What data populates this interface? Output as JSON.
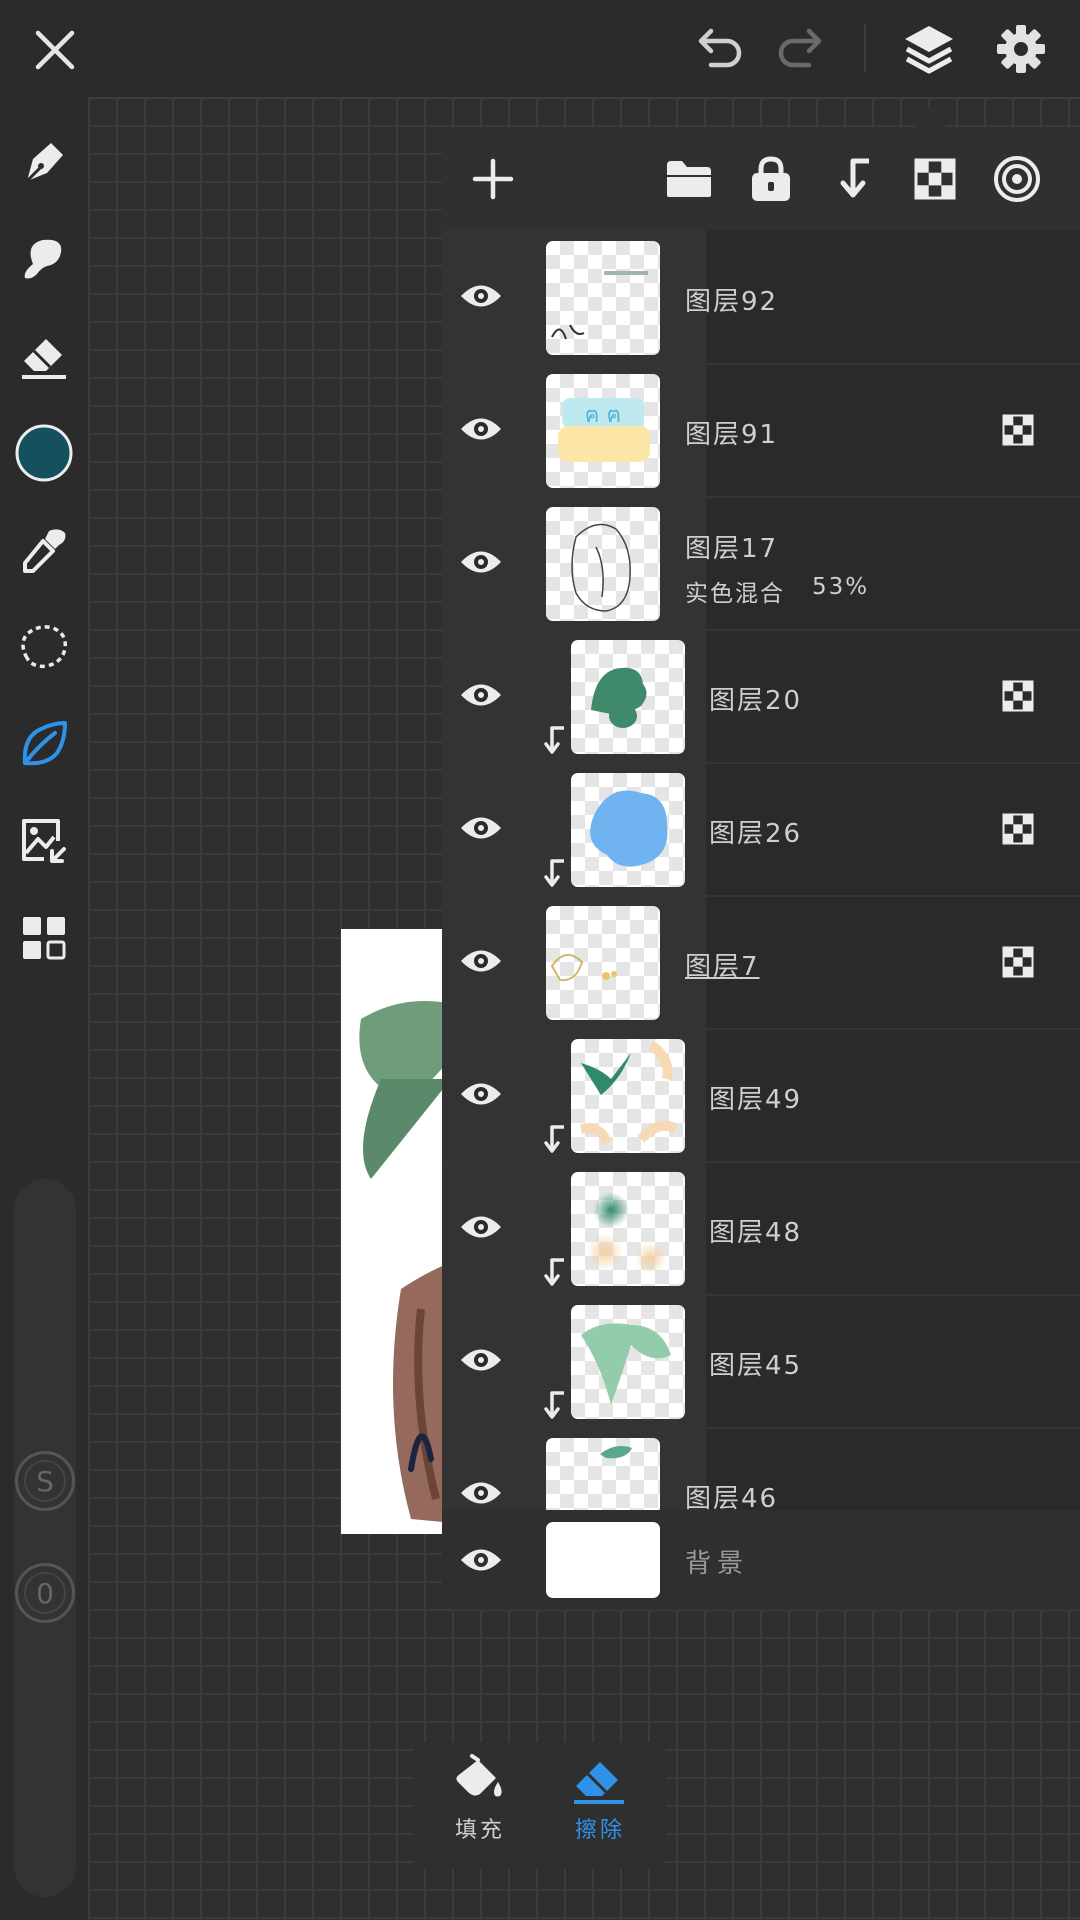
{
  "toolbar": {
    "close": "close-icon",
    "undo": "undo-icon",
    "redo": "redo-icon",
    "layers": "layers-icon",
    "settings": "gear-icon"
  },
  "left_tools": {
    "items": [
      "pen-icon",
      "smudge-icon",
      "eraser-icon",
      "color-swatch",
      "eyedropper-icon",
      "lasso-icon",
      "leaf-icon",
      "import-image-icon",
      "grid-icon"
    ],
    "current_color": "#15505e",
    "active_color": "#2e93e8",
    "size_label": "S",
    "opacity_label": "0"
  },
  "panel_header": {
    "icons": [
      "add-layer-icon",
      "folder-icon",
      "lock-icon",
      "clip-icon",
      "checker-icon",
      "target-icon"
    ]
  },
  "layers": [
    {
      "name": "图层92",
      "blend": "",
      "clipped": false,
      "alpha_lock": false
    },
    {
      "name": "图层91",
      "blend": "",
      "clipped": false,
      "alpha_lock": true
    },
    {
      "name": "图层17",
      "blend": "实色混合",
      "opacity": "53%",
      "clipped": false,
      "alpha_lock": false
    },
    {
      "name": "图层20",
      "blend": "",
      "clipped": true,
      "alpha_lock": true
    },
    {
      "name": "图层26",
      "blend": "",
      "clipped": true,
      "alpha_lock": true
    },
    {
      "name": "图层7",
      "blend": "",
      "clipped": false,
      "alpha_lock": true,
      "selected": true
    },
    {
      "name": "图层49",
      "blend": "",
      "clipped": true,
      "alpha_lock": false
    },
    {
      "name": "图层48",
      "blend": "",
      "clipped": true,
      "alpha_lock": false
    },
    {
      "name": "图层45",
      "blend": "",
      "clipped": true,
      "alpha_lock": false
    },
    {
      "name": "图层46",
      "blend": "",
      "clipped": false,
      "alpha_lock": false
    }
  ],
  "background_layer": {
    "name": "背景"
  },
  "bottom_popup": {
    "fill_label": "填充",
    "erase_label": "擦除"
  }
}
